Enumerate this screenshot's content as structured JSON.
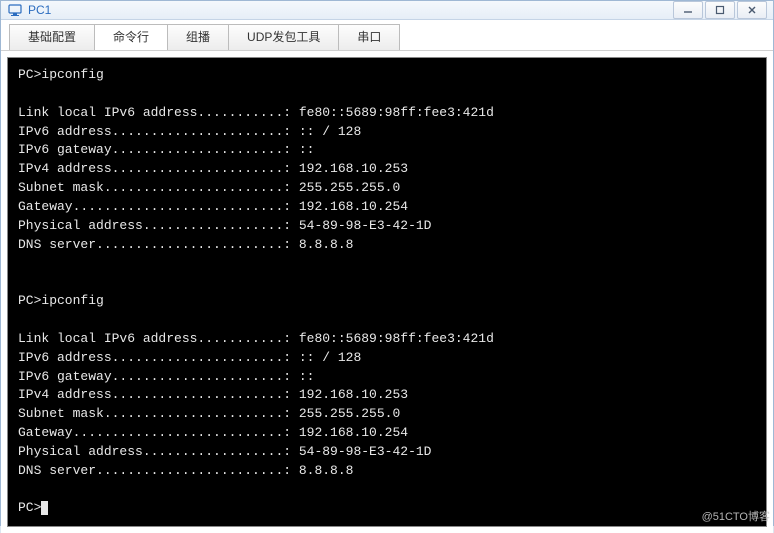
{
  "window": {
    "title": "PC1"
  },
  "tabs": {
    "t0": "基础配置",
    "t1": "命令行",
    "t2": "组播",
    "t3": "UDP发包工具",
    "t4": "串口"
  },
  "terminal": {
    "prompt1": "PC>ipconfig",
    "block1": {
      "l1": "Link local IPv6 address...........: fe80::5689:98ff:fee3:421d",
      "l2": "IPv6 address......................: :: / 128",
      "l3": "IPv6 gateway......................: ::",
      "l4": "IPv4 address......................: 192.168.10.253",
      "l5": "Subnet mask.......................: 255.255.255.0",
      "l6": "Gateway...........................: 192.168.10.254",
      "l7": "Physical address..................: 54-89-98-E3-42-1D",
      "l8": "DNS server........................: 8.8.8.8"
    },
    "prompt2": "PC>ipconfig",
    "block2": {
      "l1": "Link local IPv6 address...........: fe80::5689:98ff:fee3:421d",
      "l2": "IPv6 address......................: :: / 128",
      "l3": "IPv6 gateway......................: ::",
      "l4": "IPv4 address......................: 192.168.10.253",
      "l5": "Subnet mask.......................: 255.255.255.0",
      "l6": "Gateway...........................: 192.168.10.254",
      "l7": "Physical address..................: 54-89-98-E3-42-1D",
      "l8": "DNS server........................: 8.8.8.8"
    },
    "prompt3": "PC>"
  },
  "watermark": "@51CTO博客"
}
